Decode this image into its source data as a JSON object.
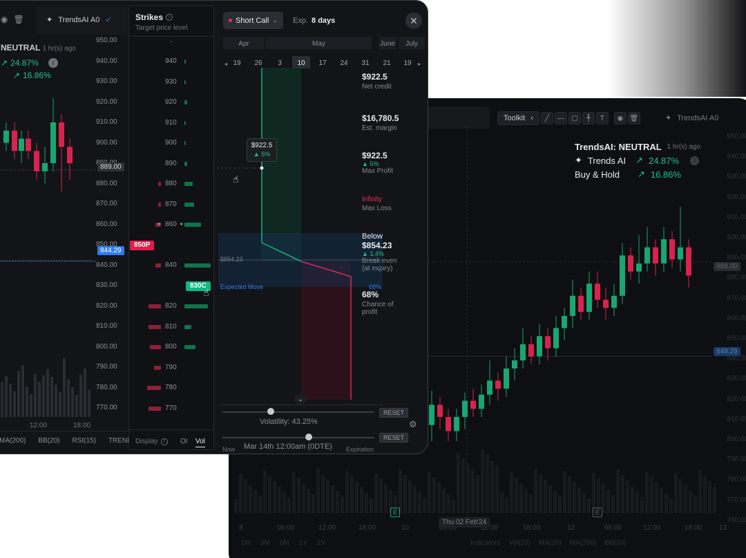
{
  "back": {
    "toolbar": {
      "toolkit_label": "Toolkit",
      "model_label": "TrendsAI A0"
    },
    "overlay": {
      "title": "TrendsAI: NEUTRAL",
      "title_sub": "1 hr(s) ago",
      "line1_label": "Trends AI",
      "line1_value": "24.87%",
      "line2_label": "Buy & Hold",
      "line2_value": "16.86%"
    },
    "y_ticks": [
      "950.00",
      "940.00",
      "930.00",
      "920.00",
      "910.00",
      "900.00",
      "890.00",
      "880.00",
      "870.00",
      "860.00",
      "850.00",
      "840.00",
      "830.00",
      "820.00",
      "810.00",
      "800.00",
      "790.00",
      "780.00",
      "770.00",
      "760.00"
    ],
    "price_tag": "889.00",
    "price_tag2": "848.29",
    "x_labels": [
      "8",
      "06:00",
      "12:00",
      "18:00",
      "10",
      "06:00",
      "12:00",
      "18:00",
      "12",
      "06:00",
      "12:00",
      "18:00",
      "13"
    ],
    "crosshair_date": "Thu 02 Feb'24",
    "timeframes": [
      "1M",
      "3M",
      "6M",
      "1Y",
      "2Y"
    ],
    "indicators": [
      "Indicators",
      "Vol(20)",
      "MA(20)",
      "MA(200)",
      "BB(20)"
    ],
    "markers": [
      "E",
      "E"
    ]
  },
  "front": {
    "left": {
      "model_label": "TrendsAI A0",
      "neutral": "NEUTRAL",
      "neutral_sub": "1 hr(s) ago",
      "v1": "24.87%",
      "v2": "16.86%",
      "y_ticks": [
        "950.00",
        "940.00",
        "930.00",
        "920.00",
        "910.00",
        "900.00",
        "890.00",
        "880.00",
        "870.00",
        "860.00",
        "850.00",
        "840.00",
        "830.00",
        "820.00",
        "810.00",
        "800.00",
        "790.00",
        "780.00",
        "770.00"
      ],
      "price_tag": "889.00",
      "price_tag_blue": "844.29",
      "x_labels": [
        "12:00",
        "18:00"
      ],
      "indicators": [
        "MA(200)",
        "BB(20)",
        "RSI(15)",
        "TREND"
      ]
    },
    "strikes": {
      "title": "Strikes",
      "subtitle": "Target price level",
      "dash": "-",
      "rows": [
        "940",
        "930",
        "920",
        "910",
        "900",
        "890",
        "880",
        "870",
        "860",
        "850",
        "840",
        "830",
        "820",
        "810",
        "800",
        "790",
        "780",
        "770"
      ],
      "put_pill": "850P",
      "call_pill": "830C",
      "footer": {
        "display": "Display",
        "oi": "OI",
        "vol": "Vol"
      }
    },
    "payoff": {
      "strategy": "Short Call",
      "exp_label": "Exp.",
      "exp_value": "8 days",
      "months": [
        "Apr",
        "May",
        "June",
        "July"
      ],
      "days": [
        "19",
        "26",
        "3",
        "10",
        "17",
        "24",
        "31",
        "21",
        "19"
      ],
      "tooltip_value": "$922.5",
      "tooltip_pct": "5%",
      "price_line": "$854.23",
      "expected_move": "Expected Move",
      "expected_pct": "68%",
      "metrics": [
        {
          "value": "$922.5",
          "sub": "Net credit"
        },
        {
          "value": "$16,780.5",
          "sub": "Est. margin"
        },
        {
          "value": "$922.5",
          "pct": "5%",
          "sub": "Max Profit"
        },
        {
          "value": "Infinity",
          "sub": "Max Loss"
        },
        {
          "value": "Below",
          "value2": "$854.23",
          "pct": "1.4%",
          "sub": "Break even",
          "sub2": "(at expiry)"
        },
        {
          "value": "68%",
          "sub": "Chance of",
          "sub2": "profit"
        }
      ],
      "volatility": "Volatility: 43.25%",
      "reset": "RESET",
      "time_now": "Now",
      "time_value": "Mar 14th 12:00am (0DTE)",
      "time_exp": "Expiration"
    }
  },
  "colors": {
    "green": "#22c08b",
    "red": "#ef2f5e",
    "blue": "#2f7cf6"
  }
}
